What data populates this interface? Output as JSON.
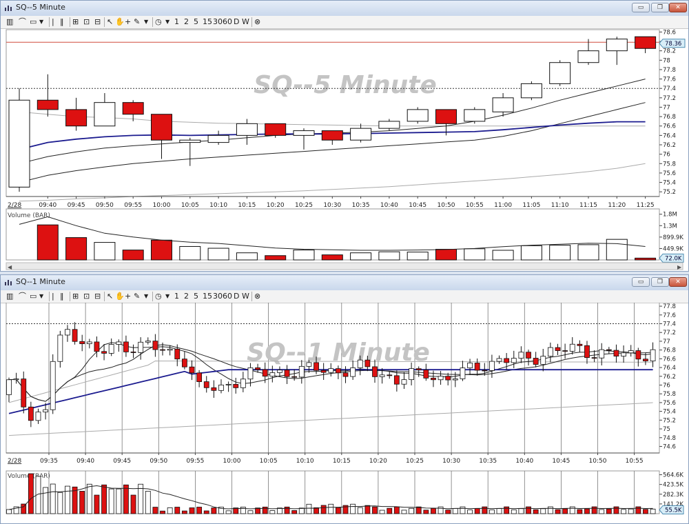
{
  "windows": [
    {
      "title": "SQ--5 Minute",
      "watermark": "SQ--5 Minute"
    },
    {
      "title": "SQ--1 Minute",
      "watermark": "SQ--1 Minute"
    }
  ],
  "toolbar": {
    "items": [
      "1",
      "2",
      "5",
      "15",
      "30",
      "60",
      "D",
      "W"
    ]
  },
  "window_controls": {
    "minimize": "▭",
    "restore": "❐",
    "close": "✕"
  },
  "date_label": "2/28",
  "volume_label": "Volume (BAR)",
  "colors": {
    "down": "#dd1111",
    "up": "#ffffff",
    "ma_blue": "#1b1b8f",
    "ma_dark": "#222222",
    "ma_gray": "#aaaaaa",
    "last_line": "#d04a3a",
    "last_badge": "#d8eef8"
  },
  "chart_data": [
    {
      "type": "candlestick",
      "title": "SQ--5 Minute",
      "last_price_label": "78.36",
      "last_price": 78.36,
      "ylim": [
        75.1,
        78.65
      ],
      "y_ticks": [
        "75.2",
        "75.4",
        "75.6",
        "75.8",
        "76",
        "76.2",
        "76.4",
        "76.6",
        "76.8",
        "77",
        "77.2",
        "77.4",
        "77.6",
        "77.8",
        "78",
        "78.2",
        "78.4",
        "78.6"
      ],
      "x_ticks": [
        "09:40",
        "09:45",
        "09:50",
        "09:55",
        "10:00",
        "10:05",
        "10:10",
        "10:15",
        "10:20",
        "10:25",
        "10:30",
        "10:35",
        "10:40",
        "10:45",
        "10:50",
        "10:55",
        "11:00",
        "11:05",
        "11:10",
        "11:15",
        "11:20",
        "11:25"
      ],
      "dotted_level": 77.4,
      "candles": [
        {
          "t": "09:35",
          "o": 75.3,
          "h": 77.4,
          "l": 75.2,
          "c": 77.15
        },
        {
          "t": "09:40",
          "o": 77.15,
          "h": 77.7,
          "l": 76.8,
          "c": 76.95
        },
        {
          "t": "09:45",
          "o": 76.95,
          "h": 77.2,
          "l": 76.5,
          "c": 76.6
        },
        {
          "t": "09:50",
          "o": 76.6,
          "h": 77.3,
          "l": 76.6,
          "c": 77.1
        },
        {
          "t": "09:55",
          "o": 77.1,
          "h": 77.15,
          "l": 76.7,
          "c": 76.85
        },
        {
          "t": "10:00",
          "o": 76.85,
          "h": 76.85,
          "l": 75.9,
          "c": 76.3
        },
        {
          "t": "10:05",
          "o": 76.25,
          "h": 76.35,
          "l": 75.75,
          "c": 76.3
        },
        {
          "t": "10:10",
          "o": 76.25,
          "h": 76.5,
          "l": 76.2,
          "c": 76.4
        },
        {
          "t": "10:15",
          "o": 76.4,
          "h": 76.75,
          "l": 76.2,
          "c": 76.65
        },
        {
          "t": "10:20",
          "o": 76.65,
          "h": 76.65,
          "l": 76.35,
          "c": 76.4
        },
        {
          "t": "10:25",
          "o": 76.4,
          "h": 76.55,
          "l": 76.1,
          "c": 76.5
        },
        {
          "t": "10:30",
          "o": 76.5,
          "h": 76.5,
          "l": 76.2,
          "c": 76.3
        },
        {
          "t": "10:35",
          "o": 76.3,
          "h": 76.65,
          "l": 76.25,
          "c": 76.55
        },
        {
          "t": "10:40",
          "o": 76.55,
          "h": 76.75,
          "l": 76.5,
          "c": 76.7
        },
        {
          "t": "10:45",
          "o": 76.7,
          "h": 77.0,
          "l": 76.65,
          "c": 76.95
        },
        {
          "t": "10:50",
          "o": 76.95,
          "h": 76.95,
          "l": 76.4,
          "c": 76.65
        },
        {
          "t": "10:55",
          "o": 76.7,
          "h": 77.0,
          "l": 76.65,
          "c": 76.95
        },
        {
          "t": "11:00",
          "o": 76.9,
          "h": 77.3,
          "l": 76.8,
          "c": 77.2
        },
        {
          "t": "11:05",
          "o": 77.2,
          "h": 77.55,
          "l": 77.15,
          "c": 77.5
        },
        {
          "t": "11:10",
          "o": 77.5,
          "h": 78.0,
          "l": 77.45,
          "c": 77.95
        },
        {
          "t": "11:15",
          "o": 77.95,
          "h": 78.45,
          "l": 77.9,
          "c": 78.2
        },
        {
          "t": "11:20",
          "o": 78.2,
          "h": 78.5,
          "l": 77.9,
          "c": 78.45
        },
        {
          "t": "11:25",
          "o": 78.5,
          "h": 78.5,
          "l": 78.15,
          "c": 78.25
        }
      ],
      "ma_blue": [
        76.1,
        76.25,
        76.32,
        76.37,
        76.4,
        76.41,
        76.4,
        76.41,
        76.42,
        76.43,
        76.43,
        76.43,
        76.44,
        76.45,
        76.46,
        76.47,
        76.48,
        76.52,
        76.57,
        76.62,
        76.66,
        76.69,
        76.69
      ],
      "ma_dark": [
        75.4,
        75.55,
        75.65,
        75.73,
        75.8,
        75.85,
        75.9,
        75.94,
        75.98,
        76.02,
        76.06,
        76.1,
        76.14,
        76.18,
        76.22,
        76.26,
        76.3,
        76.38,
        76.5,
        76.65,
        76.8,
        76.95,
        77.1
      ],
      "ma_dark2": [
        75.8,
        75.95,
        76.05,
        76.13,
        76.18,
        76.22,
        76.26,
        76.3,
        76.35,
        76.4,
        76.43,
        76.45,
        76.47,
        76.5,
        76.55,
        76.6,
        76.7,
        76.83,
        76.98,
        77.15,
        77.3,
        77.45,
        77.6
      ],
      "ma_gray": [
        76.9,
        76.85,
        76.8,
        76.78,
        76.75,
        76.7,
        76.68,
        76.66,
        76.65,
        76.64,
        76.63,
        76.62,
        76.61,
        76.6,
        76.6,
        76.6,
        76.6,
        76.6,
        76.6,
        76.6,
        76.6,
        76.6,
        76.6
      ],
      "ma_gray2": [
        75.0,
        75.02,
        75.05,
        75.07,
        75.1,
        75.12,
        75.14,
        75.16,
        75.18,
        75.2,
        75.22,
        75.25,
        75.28,
        75.31,
        75.35,
        75.39,
        75.43,
        75.47,
        75.52,
        75.57,
        75.63,
        75.7,
        75.8
      ],
      "volume": {
        "y_ticks": [
          "449.9K",
          "899.9K",
          "1.3M",
          "1.8M"
        ],
        "last_label": "72.0K",
        "ymax": 1900,
        "values": [
          0,
          1380,
          880,
          690,
          390,
          780,
          530,
          460,
          280,
          170,
          390,
          200,
          280,
          320,
          310,
          420,
          440,
          380,
          560,
          580,
          600,
          810,
          72
        ],
        "avg": [
          1400,
          1700,
          1350,
          1050,
          900,
          780,
          700,
          650,
          560,
          470,
          420,
          400,
          380,
          380,
          390,
          410,
          450,
          520,
          580,
          620,
          660,
          640,
          530
        ]
      }
    },
    {
      "type": "candlestick",
      "title": "SQ--1 Minute",
      "ylim": [
        74.45,
        77.88
      ],
      "y_ticks": [
        "74.6",
        "74.8",
        "75",
        "75.2",
        "75.4",
        "75.6",
        "75.8",
        "76",
        "76.2",
        "76.4",
        "76.6",
        "76.8",
        "77",
        "77.2",
        "77.4",
        "77.6",
        "77.8"
      ],
      "x_ticks": [
        "09:35",
        "09:40",
        "09:45",
        "09:50",
        "09:55",
        "10:00",
        "10:05",
        "10:10",
        "10:15",
        "10:20",
        "10:25",
        "10:30",
        "10:35",
        "10:40",
        "10:45",
        "10:50",
        "10:55"
      ],
      "dotted_level": 77.4,
      "volume": {
        "y_ticks": [
          "141.2K",
          "282.3K",
          "423.5K",
          "564.6K"
        ],
        "last_label": "55.5K",
        "ymax": 600
      }
    }
  ]
}
